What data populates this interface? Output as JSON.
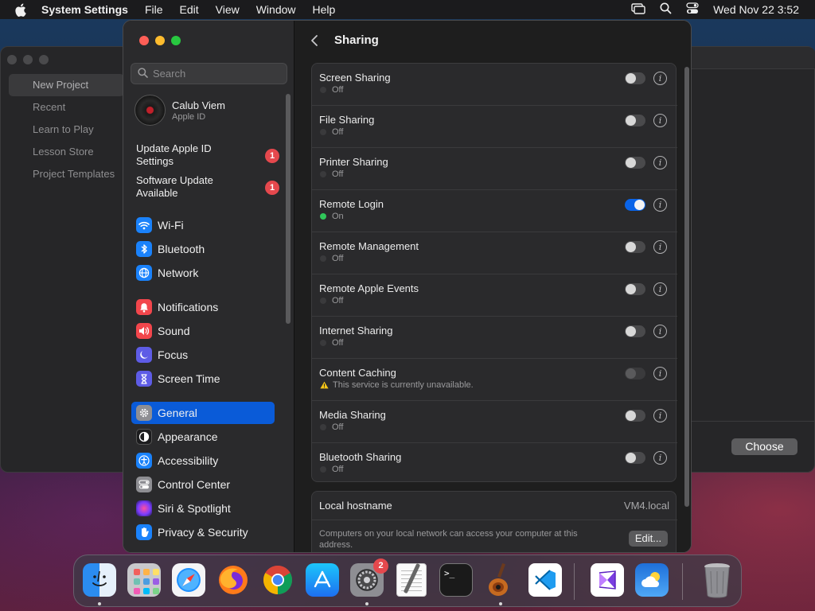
{
  "menubar": {
    "app_name": "System Settings",
    "items": [
      "File",
      "Edit",
      "View",
      "Window",
      "Help"
    ],
    "clock": "Wed Nov 22  3:52"
  },
  "background_window": {
    "sidebar_items": [
      "New Project",
      "Recent",
      "Learn to Play",
      "Lesson Store",
      "Project Templates"
    ],
    "choose_label": "Choose"
  },
  "sidebar": {
    "search_placeholder": "Search",
    "account": {
      "name": "Calub Viem",
      "sub": "Apple ID"
    },
    "notices": [
      {
        "label": "Update Apple ID Settings",
        "badge": "1"
      },
      {
        "label": "Software Update Available",
        "badge": "1"
      }
    ],
    "items": [
      {
        "label": "Wi-Fi",
        "icon": "wifi-icon",
        "color": "#1a82fb"
      },
      {
        "label": "Bluetooth",
        "icon": "bluetooth-icon",
        "color": "#1a82fb"
      },
      {
        "label": "Network",
        "icon": "globe-icon",
        "color": "#1a82fb"
      },
      {
        "label": "Notifications",
        "icon": "bell-icon",
        "color": "#f2464c"
      },
      {
        "label": "Sound",
        "icon": "speaker-icon",
        "color": "#f2464c"
      },
      {
        "label": "Focus",
        "icon": "moon-icon",
        "color": "#5e5ce6"
      },
      {
        "label": "Screen Time",
        "icon": "hourglass-icon",
        "color": "#5e5ce6"
      },
      {
        "label": "General",
        "icon": "gear-icon",
        "color": "#8e8e93"
      },
      {
        "label": "Appearance",
        "icon": "appearance-icon",
        "color": "#1c1c1e"
      },
      {
        "label": "Accessibility",
        "icon": "accessibility-icon",
        "color": "#1a82fb"
      },
      {
        "label": "Control Center",
        "icon": "control-center-icon",
        "color": "#8e8e93"
      },
      {
        "label": "Siri & Spotlight",
        "icon": "siri-icon",
        "color": "#b445e0"
      },
      {
        "label": "Privacy & Security",
        "icon": "hand-icon",
        "color": "#1a82fb"
      }
    ],
    "selected": "General"
  },
  "content": {
    "title": "Sharing",
    "services": [
      {
        "name": "Screen Sharing",
        "status": "Off",
        "state": "off"
      },
      {
        "name": "File Sharing",
        "status": "Off",
        "state": "off"
      },
      {
        "name": "Printer Sharing",
        "status": "Off",
        "state": "off"
      },
      {
        "name": "Remote Login",
        "status": "On",
        "state": "on"
      },
      {
        "name": "Remote Management",
        "status": "Off",
        "state": "off"
      },
      {
        "name": "Remote Apple Events",
        "status": "Off",
        "state": "off"
      },
      {
        "name": "Internet Sharing",
        "status": "Off",
        "state": "off"
      },
      {
        "name": "Content Caching",
        "status": "This service is currently unavailable.",
        "state": "disabled"
      },
      {
        "name": "Media Sharing",
        "status": "Off",
        "state": "off"
      },
      {
        "name": "Bluetooth Sharing",
        "status": "Off",
        "state": "off"
      }
    ],
    "hostname_label": "Local hostname",
    "hostname_value": "VM4.local",
    "hint": "Computers on your local network can access your computer at this address.",
    "edit_label": "Edit..."
  },
  "dock": {
    "apps": [
      {
        "name": "Finder",
        "icon": "finder-icon",
        "running": true
      },
      {
        "name": "Launchpad",
        "icon": "launchpad-icon",
        "running": false
      },
      {
        "name": "Safari",
        "icon": "safari-icon",
        "running": false
      },
      {
        "name": "Firefox",
        "icon": "firefox-icon",
        "running": false
      },
      {
        "name": "Chrome",
        "icon": "chrome-icon",
        "running": false
      },
      {
        "name": "App Store",
        "icon": "app-store-icon",
        "running": false
      },
      {
        "name": "System Settings",
        "icon": "system-settings-icon",
        "running": true,
        "badge": "2"
      },
      {
        "name": "TextEdit",
        "icon": "textedit-icon",
        "running": false
      },
      {
        "name": "Terminal",
        "icon": "terminal-icon",
        "running": false
      },
      {
        "name": "GarageBand",
        "icon": "garageband-icon",
        "running": true
      },
      {
        "name": "Visual Studio Code",
        "icon": "vscode-icon",
        "running": false
      },
      {
        "name": "Visual Studio",
        "icon": "visual-studio-icon",
        "running": false
      },
      {
        "name": "Weather",
        "icon": "weather-icon",
        "running": false
      },
      {
        "name": "Trash",
        "icon": "trash-icon",
        "running": false
      }
    ]
  }
}
